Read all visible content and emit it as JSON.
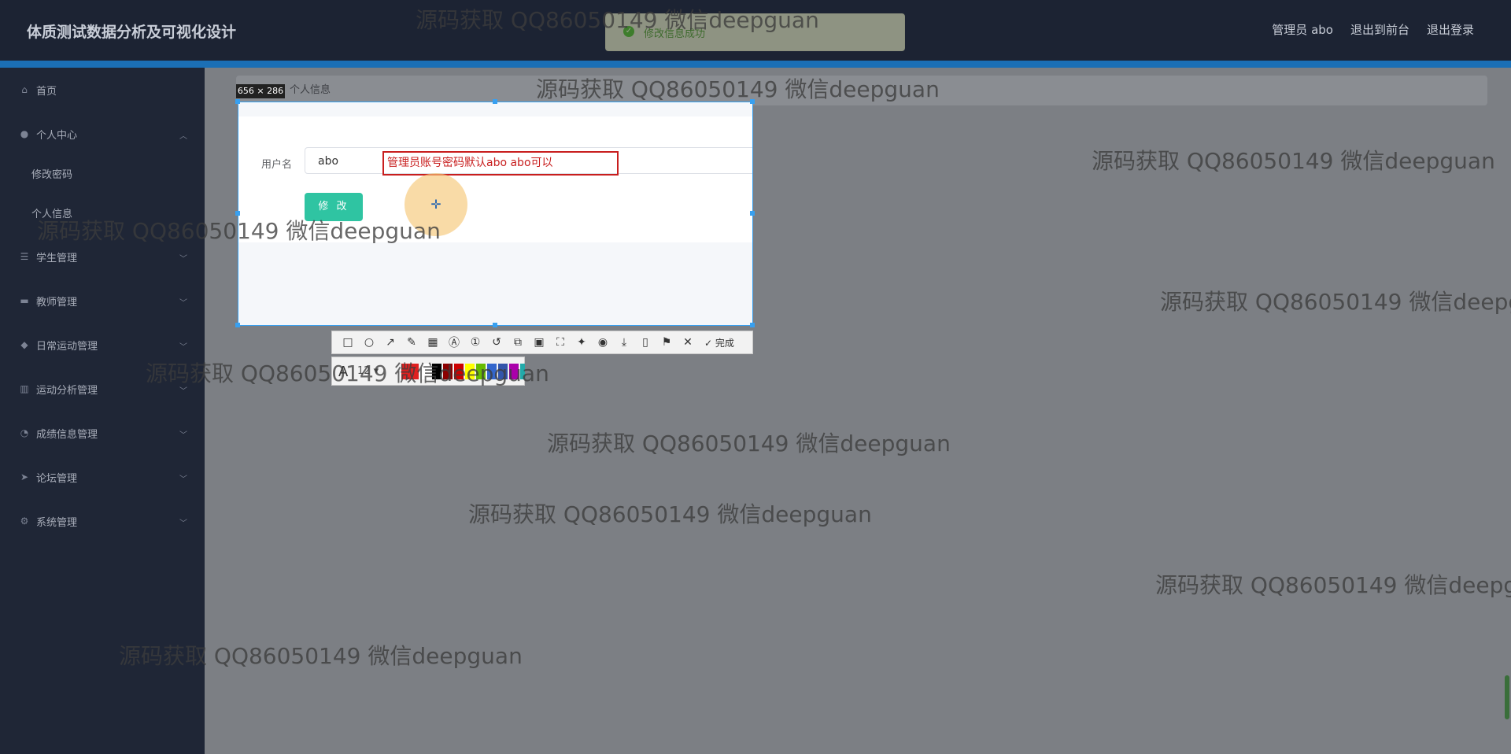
{
  "app": {
    "title": "体质测试数据分析及可视化设计",
    "header_links": [
      "管理员 abo",
      "退出到前台",
      "退出登录"
    ]
  },
  "sidebar": {
    "items": [
      {
        "label": "首页",
        "icon": "home-icon"
      },
      {
        "label": "个人中心",
        "icon": "user-icon",
        "expanded": true,
        "children": [
          "修改密码",
          "个人信息"
        ]
      },
      {
        "label": "学生管理",
        "icon": "list-icon"
      },
      {
        "label": "教师管理",
        "icon": "monitor-icon"
      },
      {
        "label": "日常运动管理",
        "icon": "location-icon"
      },
      {
        "label": "运动分析管理",
        "icon": "chart-icon"
      },
      {
        "label": "成绩信息管理",
        "icon": "clock-icon"
      },
      {
        "label": "论坛管理",
        "icon": "send-icon"
      },
      {
        "label": "系统管理",
        "icon": "settings-icon"
      }
    ]
  },
  "breadcrumb": {
    "current": "个人信息"
  },
  "toast": {
    "message": "修改信息成功",
    "icon": "check-circle-icon"
  },
  "form": {
    "username_label": "用户名",
    "username_value": "abo",
    "submit_label": "修 改"
  },
  "screenshot_tool": {
    "size_label": "656 × 286",
    "annotation_text": "管理员账号密码默认abo abo可以",
    "done_label": "完成",
    "font_size": "12",
    "palette": [
      "#e02020",
      "#ffffff",
      "#000000",
      "#8b0000",
      "#cc0000",
      "#ffff00",
      "#66bb00",
      "#3366cc",
      "#3355aa",
      "#aa00aa",
      "#22aaaa"
    ]
  },
  "watermark": "源码获取 QQ86050149 微信deepguan"
}
